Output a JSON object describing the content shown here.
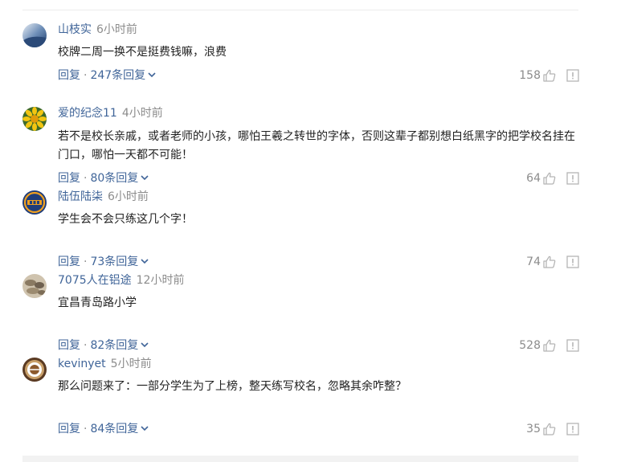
{
  "comments": [
    {
      "username": "山枝实",
      "time": "6小时前",
      "text": "校牌二周一换不是挺费钱嘛，浪费",
      "reply_label": "回复",
      "separator": "·",
      "reply_count": "247条回复",
      "likes": "158",
      "avatar_icon": "sky-avatar"
    },
    {
      "username": "爱的纪念11",
      "time": "4小时前",
      "text": "若不是校长亲戚，或者老师的小孩，哪怕王羲之转世的字体，否则这辈子都别想白纸黑字的把学校名挂在门口，哪怕一天都不可能！",
      "reply_label": "回复",
      "separator": "·",
      "reply_count": "80条回复",
      "likes": "64",
      "avatar_icon": "sunflower-avatar"
    },
    {
      "username": "陆伍陆柒",
      "time": "6小时前",
      "text": "学生会不会只练这几个字！",
      "reply_label": "回复",
      "separator": "·",
      "reply_count": "73条回复",
      "likes": "74",
      "avatar_icon": "logo-avatar"
    },
    {
      "username": "7075人在铝途",
      "time": "12小时前",
      "text": "宜昌青岛路小学",
      "reply_label": "回复",
      "separator": "·",
      "reply_count": "82条回复",
      "likes": "528",
      "avatar_icon": "rocks-avatar"
    },
    {
      "username": "kevinyet",
      "time": "5小时前",
      "text": "那么问题来了：一部分学生为了上榜，整天练写校名，忽略其余咋整？",
      "reply_label": "回复",
      "separator": "·",
      "reply_count": "84条回复",
      "likes": "35",
      "avatar_icon": "badge-avatar"
    }
  ],
  "colors": {
    "username": "#406599",
    "meta": "#8c8c8c",
    "text": "#222222",
    "icon": "#b5b5b5"
  }
}
